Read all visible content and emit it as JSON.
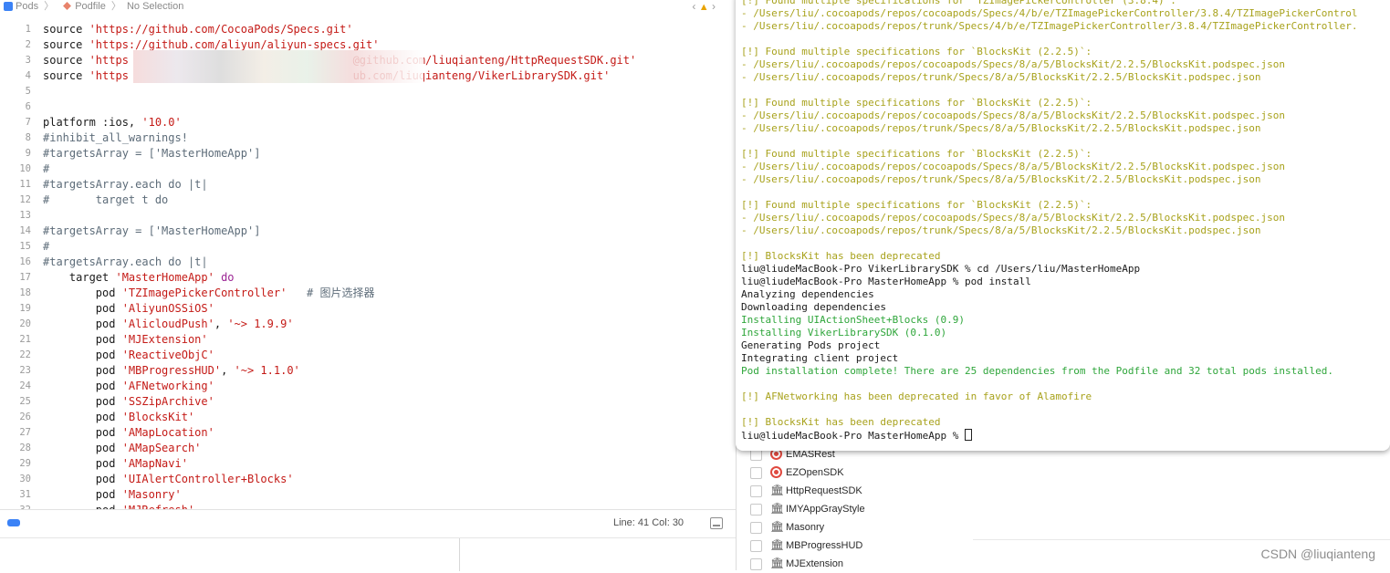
{
  "jumpbar": {
    "project": "Pods",
    "file": "Podfile",
    "selection": "No Selection"
  },
  "code_lines": [
    {
      "n": "1",
      "segs": [
        {
          "t": "source ",
          "c": ""
        },
        {
          "t": "'https://github.com/CocoaPods/Specs.git'",
          "c": "str"
        }
      ]
    },
    {
      "n": "2",
      "segs": [
        {
          "t": "source ",
          "c": ""
        },
        {
          "t": "'https://github.com/aliyun/aliyun-specs.git'",
          "c": "str"
        }
      ]
    },
    {
      "n": "3",
      "segs": [
        {
          "t": "source ",
          "c": ""
        },
        {
          "t": "'https                                  @github.com/liuqianteng/HttpRequestSDK.git'",
          "c": "str"
        }
      ]
    },
    {
      "n": "4",
      "segs": [
        {
          "t": "source ",
          "c": ""
        },
        {
          "t": "'https                                  ub.com/liuqianteng/VikerLibrarySDK.git'",
          "c": "str"
        }
      ]
    },
    {
      "n": "5",
      "segs": []
    },
    {
      "n": "6",
      "segs": []
    },
    {
      "n": "7",
      "segs": [
        {
          "t": "platform :ios, ",
          "c": ""
        },
        {
          "t": "'10.0'",
          "c": "str"
        }
      ]
    },
    {
      "n": "8",
      "segs": [
        {
          "t": "#inhibit_all_warnings!",
          "c": "cmt"
        }
      ]
    },
    {
      "n": "9",
      "segs": [
        {
          "t": "#targetsArray = ['MasterHomeApp']",
          "c": "cmt"
        }
      ]
    },
    {
      "n": "10",
      "segs": [
        {
          "t": "#",
          "c": "cmt"
        }
      ]
    },
    {
      "n": "11",
      "segs": [
        {
          "t": "#targetsArray.each do |t|",
          "c": "cmt"
        }
      ]
    },
    {
      "n": "12",
      "segs": [
        {
          "t": "#       target t do",
          "c": "cmt"
        }
      ]
    },
    {
      "n": "13",
      "segs": []
    },
    {
      "n": "14",
      "segs": [
        {
          "t": "#targetsArray = ['MasterHomeApp']",
          "c": "cmt"
        }
      ]
    },
    {
      "n": "15",
      "segs": [
        {
          "t": "#",
          "c": "cmt"
        }
      ]
    },
    {
      "n": "16",
      "segs": [
        {
          "t": "#targetsArray.each do |t|",
          "c": "cmt"
        }
      ]
    },
    {
      "n": "17",
      "segs": [
        {
          "t": "    target ",
          "c": ""
        },
        {
          "t": "'MasterHomeApp'",
          "c": "str"
        },
        {
          "t": " do",
          "c": "kw"
        }
      ]
    },
    {
      "n": "18",
      "segs": [
        {
          "t": "        pod ",
          "c": ""
        },
        {
          "t": "'TZImagePickerController'",
          "c": "str"
        },
        {
          "t": "   # 图片选择器",
          "c": "cmt"
        }
      ]
    },
    {
      "n": "19",
      "segs": [
        {
          "t": "        pod ",
          "c": ""
        },
        {
          "t": "'AliyunOSSiOS'",
          "c": "str"
        }
      ]
    },
    {
      "n": "20",
      "segs": [
        {
          "t": "        pod ",
          "c": ""
        },
        {
          "t": "'AlicloudPush'",
          "c": "str"
        },
        {
          "t": ", ",
          "c": ""
        },
        {
          "t": "'~> 1.9.9'",
          "c": "str"
        }
      ]
    },
    {
      "n": "21",
      "segs": [
        {
          "t": "        pod ",
          "c": ""
        },
        {
          "t": "'MJExtension'",
          "c": "str"
        }
      ]
    },
    {
      "n": "22",
      "segs": [
        {
          "t": "        pod ",
          "c": ""
        },
        {
          "t": "'ReactiveObjC'",
          "c": "str"
        }
      ]
    },
    {
      "n": "23",
      "segs": [
        {
          "t": "        pod ",
          "c": ""
        },
        {
          "t": "'MBProgressHUD'",
          "c": "str"
        },
        {
          "t": ", ",
          "c": ""
        },
        {
          "t": "'~> 1.1.0'",
          "c": "str"
        }
      ]
    },
    {
      "n": "24",
      "segs": [
        {
          "t": "        pod ",
          "c": ""
        },
        {
          "t": "'AFNetworking'",
          "c": "str"
        }
      ]
    },
    {
      "n": "25",
      "segs": [
        {
          "t": "        pod ",
          "c": ""
        },
        {
          "t": "'SSZipArchive'",
          "c": "str"
        }
      ]
    },
    {
      "n": "26",
      "segs": [
        {
          "t": "        pod ",
          "c": ""
        },
        {
          "t": "'BlocksKit'",
          "c": "str"
        }
      ]
    },
    {
      "n": "27",
      "segs": [
        {
          "t": "        pod ",
          "c": ""
        },
        {
          "t": "'AMapLocation'",
          "c": "str"
        }
      ]
    },
    {
      "n": "28",
      "segs": [
        {
          "t": "        pod ",
          "c": ""
        },
        {
          "t": "'AMapSearch'",
          "c": "str"
        }
      ]
    },
    {
      "n": "29",
      "segs": [
        {
          "t": "        pod ",
          "c": ""
        },
        {
          "t": "'AMapNavi'",
          "c": "str"
        }
      ]
    },
    {
      "n": "30",
      "segs": [
        {
          "t": "        pod ",
          "c": ""
        },
        {
          "t": "'UIAlertController+Blocks'",
          "c": "str"
        }
      ]
    },
    {
      "n": "31",
      "segs": [
        {
          "t": "        pod ",
          "c": ""
        },
        {
          "t": "'Masonry'",
          "c": "str"
        }
      ]
    },
    {
      "n": "32",
      "segs": [
        {
          "t": "        pod ",
          "c": ""
        },
        {
          "t": "'MJRefresh'",
          "c": "str"
        }
      ]
    }
  ],
  "status": {
    "line_col": "Line: 41  Col: 30"
  },
  "terminal_lines": [
    {
      "t": "[!] Found multiple specifications for `TZImagePickerController (3.8.4)`:",
      "k": "warn"
    },
    {
      "t": "- /Users/liu/.cocoapods/repos/cocoapods/Specs/4/b/e/TZImagePickerController/3.8.4/TZImagePickerControl",
      "k": "warn"
    },
    {
      "t": "- /Users/liu/.cocoapods/repos/trunk/Specs/4/b/e/TZImagePickerController/3.8.4/TZImagePickerController.",
      "k": "warn"
    },
    {
      "t": "",
      "k": ""
    },
    {
      "t": "[!] Found multiple specifications for `BlocksKit (2.2.5)`:",
      "k": "warn"
    },
    {
      "t": "- /Users/liu/.cocoapods/repos/cocoapods/Specs/8/a/5/BlocksKit/2.2.5/BlocksKit.podspec.json",
      "k": "warn"
    },
    {
      "t": "- /Users/liu/.cocoapods/repos/trunk/Specs/8/a/5/BlocksKit/2.2.5/BlocksKit.podspec.json",
      "k": "warn"
    },
    {
      "t": "",
      "k": ""
    },
    {
      "t": "[!] Found multiple specifications for `BlocksKit (2.2.5)`:",
      "k": "warn"
    },
    {
      "t": "- /Users/liu/.cocoapods/repos/cocoapods/Specs/8/a/5/BlocksKit/2.2.5/BlocksKit.podspec.json",
      "k": "warn"
    },
    {
      "t": "- /Users/liu/.cocoapods/repos/trunk/Specs/8/a/5/BlocksKit/2.2.5/BlocksKit.podspec.json",
      "k": "warn"
    },
    {
      "t": "",
      "k": ""
    },
    {
      "t": "[!] Found multiple specifications for `BlocksKit (2.2.5)`:",
      "k": "warn"
    },
    {
      "t": "- /Users/liu/.cocoapods/repos/cocoapods/Specs/8/a/5/BlocksKit/2.2.5/BlocksKit.podspec.json",
      "k": "warn"
    },
    {
      "t": "- /Users/liu/.cocoapods/repos/trunk/Specs/8/a/5/BlocksKit/2.2.5/BlocksKit.podspec.json",
      "k": "warn"
    },
    {
      "t": "",
      "k": ""
    },
    {
      "t": "[!] Found multiple specifications for `BlocksKit (2.2.5)`:",
      "k": "warn"
    },
    {
      "t": "- /Users/liu/.cocoapods/repos/cocoapods/Specs/8/a/5/BlocksKit/2.2.5/BlocksKit.podspec.json",
      "k": "warn"
    },
    {
      "t": "- /Users/liu/.cocoapods/repos/trunk/Specs/8/a/5/BlocksKit/2.2.5/BlocksKit.podspec.json",
      "k": "warn"
    },
    {
      "t": "",
      "k": ""
    },
    {
      "t": "[!] BlocksKit has been deprecated",
      "k": "warn"
    },
    {
      "t": "liu@liudeMacBook-Pro VikerLibrarySDK % cd /Users/liu/MasterHomeApp",
      "k": ""
    },
    {
      "t": "liu@liudeMacBook-Pro MasterHomeApp % pod install",
      "k": ""
    },
    {
      "t": "Analyzing dependencies",
      "k": ""
    },
    {
      "t": "Downloading dependencies",
      "k": ""
    },
    {
      "t": "Installing UIActionSheet+Blocks (0.9)",
      "k": "ok"
    },
    {
      "t": "Installing VikerLibrarySDK (0.1.0)",
      "k": "ok"
    },
    {
      "t": "Generating Pods project",
      "k": ""
    },
    {
      "t": "Integrating client project",
      "k": ""
    },
    {
      "t": "Pod installation complete! There are 25 dependencies from the Podfile and 32 total pods installed.",
      "k": "ok"
    },
    {
      "t": "",
      "k": ""
    },
    {
      "t": "[!] AFNetworking has been deprecated in favor of Alamofire",
      "k": "warn"
    },
    {
      "t": "",
      "k": ""
    },
    {
      "t": "[!] BlocksKit has been deprecated",
      "k": "warn"
    }
  ],
  "prompt": "liu@liudeMacBook-Pro MasterHomeApp % ",
  "navigator_items": [
    {
      "label": "EMASRest",
      "icon": "target-icon"
    },
    {
      "label": "EZOpenSDK",
      "icon": "target-icon"
    },
    {
      "label": "HttpRequestSDK",
      "icon": "library-icon"
    },
    {
      "label": "IMYAppGrayStyle",
      "icon": "library-icon"
    },
    {
      "label": "Masonry",
      "icon": "library-icon"
    },
    {
      "label": "MBProgressHUD",
      "icon": "library-icon"
    },
    {
      "label": "MJExtension",
      "icon": "library-icon"
    }
  ],
  "watermark": "CSDN @liuqianteng"
}
